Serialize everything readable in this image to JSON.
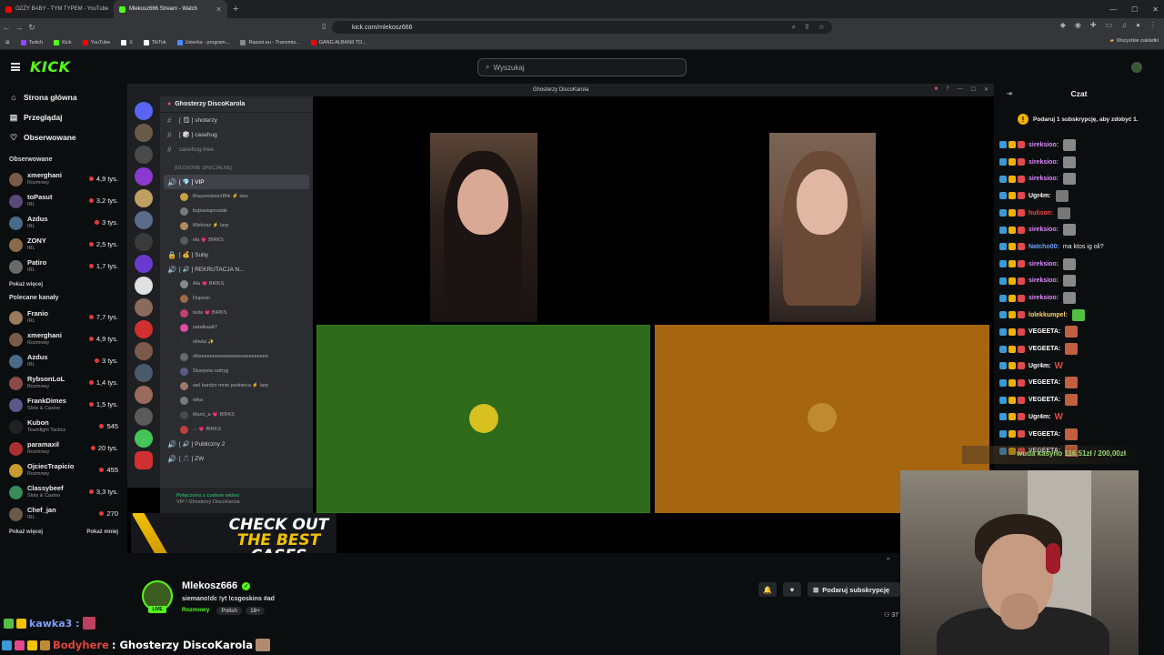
{
  "browser": {
    "tabs": [
      {
        "label": "OZZY BABY - TYM TYPEM - YouTube",
        "color": "#ff0000",
        "active": false
      },
      {
        "label": "Mlekosz666 Stream - Watch",
        "color": "#53fc18",
        "active": true
      }
    ],
    "url": "kick.com/mlekosz666",
    "bookmarks": [
      {
        "label": "Twitch",
        "color": "#9146ff"
      },
      {
        "label": "Kick",
        "color": "#53fc18"
      },
      {
        "label": "YouTube",
        "color": "#ff0000"
      },
      {
        "label": "X",
        "color": "#ffffff"
      },
      {
        "label": "TikTok",
        "color": "#ffffff"
      },
      {
        "label": "Usterka - program...",
        "color": "#4a8cff"
      },
      {
        "label": "Raszei.eu - Transmis...",
        "color": "#888888"
      },
      {
        "label": "GANG ALBANII TO...",
        "color": "#ff0000"
      }
    ],
    "bookmarks_all": "Wszystkie zakładki"
  },
  "nav": {
    "logo": "KICK",
    "search_placeholder": "Wyszukaj"
  },
  "sidebar": {
    "links": [
      {
        "label": "Strona główna",
        "icon": "home-icon",
        "glyph": "⌂"
      },
      {
        "label": "Przeglądaj",
        "icon": "browse-icon",
        "glyph": "▤"
      },
      {
        "label": "Obserwowane",
        "icon": "heart-icon",
        "glyph": "♡"
      }
    ],
    "followed_title": "Obserwowane",
    "followed": [
      {
        "name": "xmerghani",
        "cat": "Rozmowy",
        "viewers": "4,9 tys.",
        "color": "#7a5a4a"
      },
      {
        "name": "toPasut",
        "cat": "IRL",
        "viewers": "3,2 tys.",
        "color": "#5a4a7a"
      },
      {
        "name": "Azdus",
        "cat": "IRL",
        "viewers": "3 tys.",
        "color": "#4a6a8a"
      },
      {
        "name": "ZONY",
        "cat": "IRL",
        "viewers": "2,5 tys.",
        "color": "#8a6a4a"
      },
      {
        "name": "Patiro",
        "cat": "IRL",
        "viewers": "1,7 tys.",
        "color": "#6a6a6a"
      }
    ],
    "followed_more": "Pokaż więcej",
    "recommended_title": "Polecane kanały",
    "recommended": [
      {
        "name": "Franio",
        "cat": "IRL",
        "viewers": "7,7 tys.",
        "color": "#9a7a5a"
      },
      {
        "name": "xmerghani",
        "cat": "Rozmowy",
        "viewers": "4,9 tys.",
        "color": "#7a5a4a"
      },
      {
        "name": "Azdus",
        "cat": "IRL",
        "viewers": "3 tys.",
        "color": "#4a6a8a"
      },
      {
        "name": "RybsonLoL",
        "cat": "Rozmowy",
        "viewers": "1,4 tys.",
        "color": "#8a4a4a"
      },
      {
        "name": "FrankDimes",
        "cat": "Slots & Casino",
        "viewers": "1,5 tys.",
        "color": "#5a5a8a"
      },
      {
        "name": "Kubon",
        "cat": "Teamfight Tactics",
        "viewers": "545",
        "color": "#222222"
      },
      {
        "name": "paramaxil",
        "cat": "Rozmowy",
        "viewers": "20 tys.",
        "color": "#aa3030"
      },
      {
        "name": "OjciecTrapicio",
        "cat": "Rozmowy",
        "viewers": "455",
        "color": "#c89a30"
      },
      {
        "name": "Classybeef",
        "cat": "Slots & Casino",
        "viewers": "3,3 tys.",
        "color": "#3a8a5a"
      },
      {
        "name": "Chef_jan",
        "cat": "IRL",
        "viewers": "270",
        "color": "#6a5a4a"
      }
    ],
    "show_more": "Pokaż więcej",
    "show_less": "Pokaż mniej"
  },
  "discord": {
    "window_title": "Ghosterzy DiscoKarola",
    "guild": "Ghosterzy DiscoKarola",
    "text_channels": [
      {
        "label": "[ 🗒 ] shoterzy"
      },
      {
        "label": "[ 🎲 ] casehug"
      },
      {
        "label": "casehug-free"
      }
    ],
    "voice_category": "[GŁOSOWE SPECJALNE]",
    "vip_channel": "[ 💎 ] VIP",
    "vip_users": [
      "lKaysootworz8hk ⚡ larp",
      "bujkasiaprosiak",
      "Mlekosz ⚡ larp",
      "ola 💗 BIRKS"
    ],
    "suby_channel": "[ 💰 ] Suby",
    "rekrutacja_channel": "[ 🔊 ] REKRUTACJA N...",
    "rek_users": [
      "Ala 💗 BIRKS",
      "Dupson",
      "twila 💗 BIRKS",
      "natalkaa47",
      "oliwka ✨",
      "olliseeeeeeeeeeeeeeeeeeeeeeee",
      "Skarpeta rodryg",
      "wel bardzo mnie podnieca ⚡ larp",
      "wika",
      "Marci_a 💗 BIRKS",
      "... 💗 BIRKS"
    ],
    "other_channels": [
      "[ 🔊 ] Publiczny 2",
      "[ 🎵 ] ZW"
    ],
    "voice_status": "Połączono z czatem wideo",
    "voice_location": "VIP / Ghosterzy DiscoKarola"
  },
  "ad": {
    "line1": "CHECK OUT",
    "line2": "THE BEST",
    "line3": "CASES"
  },
  "chat": {
    "title": "Czat",
    "pinned": "Podaruj 1 subskrypcję, aby zdobyć 1.",
    "messages": [
      {
        "user": "sireksioo:",
        "text": "",
        "color": "#e08cff",
        "emote": "#888888"
      },
      {
        "user": "sireksioo:",
        "text": "",
        "color": "#e08cff",
        "emote": "#888888"
      },
      {
        "user": "sireksioo:",
        "text": "",
        "color": "#e08cff",
        "emote": "#888888"
      },
      {
        "user": "Ugr4m:",
        "text": "",
        "color": "#ffffff",
        "emote": "#777777"
      },
      {
        "user": "hulison:",
        "text": "",
        "color": "#ff4545",
        "emote": "#777777"
      },
      {
        "user": "sireksioo:",
        "text": "",
        "color": "#e08cff",
        "emote": "#888888"
      },
      {
        "user": "Natcho00:",
        "text": "ma ktos ig oli?",
        "color": "#6aa0ff",
        "emote": ""
      },
      {
        "user": "sireksioo:",
        "text": "",
        "color": "#e08cff",
        "emote": "#888888"
      },
      {
        "user": "sireksioo:",
        "text": "",
        "color": "#e08cff",
        "emote": "#888888"
      },
      {
        "user": "sireksioo:",
        "text": "",
        "color": "#e08cff",
        "emote": "#888888"
      },
      {
        "user": "lolekkumpel:",
        "text": "",
        "color": "#ffd36a",
        "emote": "#53c043"
      },
      {
        "user": "VEGEETA:",
        "text": "",
        "color": "#ffffff",
        "emote": "#c06040"
      },
      {
        "user": "VEGEETA:",
        "text": "",
        "color": "#ffffff",
        "emote": "#c06040"
      },
      {
        "user": "Ugr4m:",
        "text": "W",
        "color": "#ffffff",
        "emote": ""
      },
      {
        "user": "VEGEETA:",
        "text": "",
        "color": "#ffffff",
        "emote": "#c06040"
      },
      {
        "user": "VEGEETA:",
        "text": "",
        "color": "#ffffff",
        "emote": "#c06040"
      },
      {
        "user": "Ugr4m:",
        "text": "W",
        "color": "#ffffff",
        "emote": ""
      },
      {
        "user": "VEGEETA:",
        "text": "",
        "color": "#ffffff",
        "emote": "#c06040"
      },
      {
        "user": "VEGEETA:",
        "text": "",
        "color": "#ffffff",
        "emote": "#c06040"
      }
    ],
    "donation": "wuda kasyno 116,51zł / 200,00zł"
  },
  "stream": {
    "streamer": "Mlekosz666",
    "live_badge": "LIVE",
    "title": "siemano!dc !yt !csgoskins #ad",
    "category": "Rozmowy",
    "tags": [
      "Polish",
      "18+"
    ],
    "subscribe_label": "Podaruj subskrypcję",
    "viewers": "37"
  },
  "overlay": {
    "line1_user": "kawka3 :",
    "line2_user": "Bodyhere",
    "line2_text": ": Ghosterzy DiscoKarola"
  }
}
